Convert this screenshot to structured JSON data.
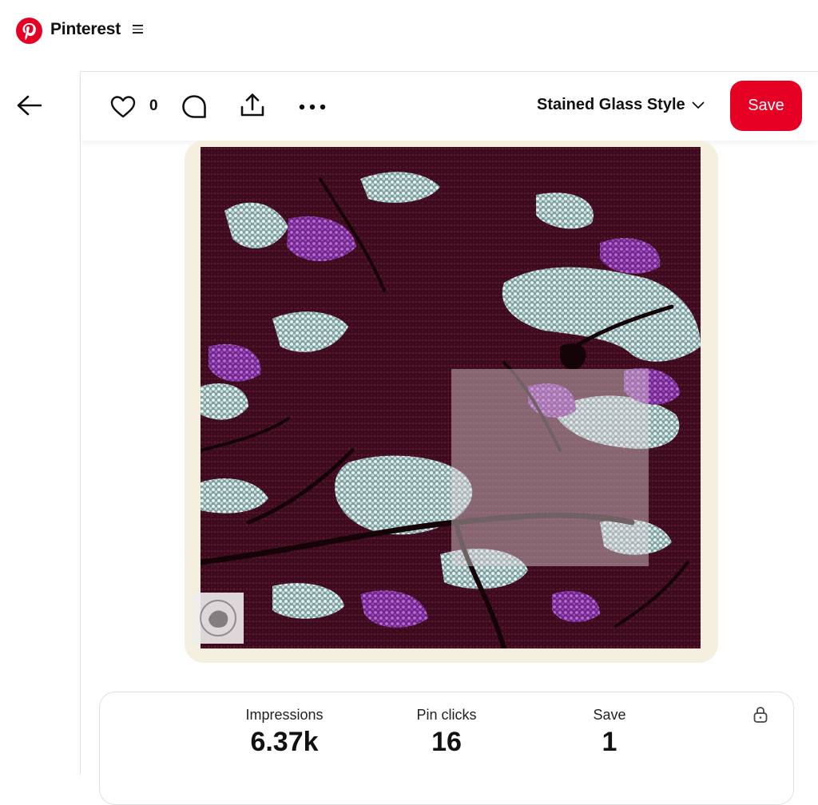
{
  "header": {
    "brand": "Pinterest"
  },
  "pin": {
    "like_count": "0",
    "board_name": "Stained Glass Style",
    "save_label": "Save"
  },
  "stats": {
    "impressions_label": "Impressions",
    "impressions_value": "6.37k",
    "pin_clicks_label": "Pin clicks",
    "pin_clicks_value": "16",
    "save_label": "Save",
    "save_value": "1"
  },
  "icons": {
    "logo": "pinterest-logo",
    "menu": "hamburger-icon",
    "back": "back-arrow-icon",
    "like": "heart-icon",
    "comment": "comment-icon",
    "share": "share-icon",
    "more": "more-icon",
    "board_dropdown": "chevron-down-icon",
    "expand": "expand-icon",
    "visual_search": "lens-search-icon",
    "lock": "lock-icon"
  },
  "colors": {
    "brand_red": "#e60023",
    "image_dark": "#3a0c1e",
    "image_purple": "#b54fd6",
    "image_light": "#cfe3e2"
  }
}
